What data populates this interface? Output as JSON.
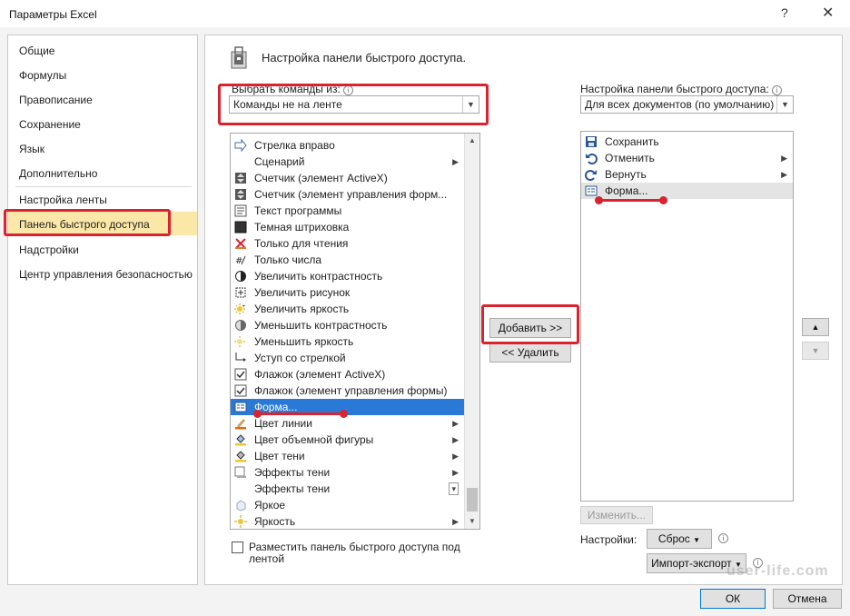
{
  "window": {
    "title": "Параметры Excel",
    "help_glyph": "?",
    "close_glyph": "✕"
  },
  "nav": {
    "items": [
      {
        "label": "Общие"
      },
      {
        "label": "Формулы"
      },
      {
        "label": "Правописание"
      },
      {
        "label": "Сохранение"
      },
      {
        "label": "Язык"
      },
      {
        "label": "Дополнительно"
      },
      {
        "label": "Настройка ленты"
      },
      {
        "label": "Панель быстрого доступа"
      },
      {
        "label": "Надстройки"
      },
      {
        "label": "Центр управления безопасностью"
      }
    ],
    "selected_index": 7
  },
  "header": {
    "title": "Настройка панели быстрого доступа."
  },
  "choose_commands": {
    "label": "Выбрать команды из:",
    "value": "Команды не на ленте"
  },
  "customize_qat": {
    "label": "Настройка панели быстрого доступа:",
    "value": "Для всех документов (по умолчанию)"
  },
  "commands_list": {
    "items": [
      {
        "label": "Стрелка вправо",
        "icon": "arrow-right-icon",
        "submenu": false
      },
      {
        "label": "Сценарий",
        "icon": "none",
        "submenu": true
      },
      {
        "label": "Счетчик (элемент ActiveX)",
        "icon": "spinner-icon",
        "submenu": false
      },
      {
        "label": "Счетчик (элемент управления форм...",
        "icon": "spinner-icon",
        "submenu": false
      },
      {
        "label": "Текст программы",
        "icon": "code-text-icon",
        "submenu": false
      },
      {
        "label": "Темная штриховка",
        "icon": "dark-shading-icon",
        "submenu": false
      },
      {
        "label": "Только для чтения",
        "icon": "read-only-icon",
        "submenu": false
      },
      {
        "label": "Только числа",
        "icon": "numbers-only-icon",
        "submenu": false
      },
      {
        "label": "Увеличить контрастность",
        "icon": "contrast-up-icon",
        "submenu": false
      },
      {
        "label": "Увеличить рисунок",
        "icon": "enlarge-picture-icon",
        "submenu": false
      },
      {
        "label": "Увеличить яркость",
        "icon": "brightness-up-icon",
        "submenu": false
      },
      {
        "label": "Уменьшить контрастность",
        "icon": "contrast-down-icon",
        "submenu": false
      },
      {
        "label": "Уменьшить яркость",
        "icon": "brightness-down-icon",
        "submenu": false
      },
      {
        "label": "Уступ со стрелкой",
        "icon": "elbow-arrow-icon",
        "submenu": false
      },
      {
        "label": "Флажок (элемент ActiveX)",
        "icon": "checkbox-icon",
        "submenu": false
      },
      {
        "label": "Флажок (элемент управления формы)",
        "icon": "checkbox-icon",
        "submenu": false
      },
      {
        "label": "Форма...",
        "icon": "form-icon",
        "submenu": false,
        "selected": true
      },
      {
        "label": "Цвет линии",
        "icon": "line-color-icon",
        "submenu": true
      },
      {
        "label": "Цвет объемной фигуры",
        "icon": "fill-3d-color-icon",
        "submenu": true
      },
      {
        "label": "Цвет тени",
        "icon": "shadow-color-icon",
        "submenu": true
      },
      {
        "label": "Эффекты тени",
        "icon": "shadow-effects-icon",
        "submenu": true
      },
      {
        "label": "Эффекты тени",
        "icon": "none",
        "submenu": false,
        "dropdown": true
      },
      {
        "label": "Яркое",
        "icon": "bright-icon",
        "submenu": false
      },
      {
        "label": "Яркость",
        "icon": "brightness-icon",
        "submenu": true
      }
    ]
  },
  "qat_list": {
    "items": [
      {
        "label": "Сохранить",
        "icon": "save-icon",
        "submenu": false
      },
      {
        "label": "Отменить",
        "icon": "undo-icon",
        "submenu": true
      },
      {
        "label": "Вернуть",
        "icon": "redo-icon",
        "submenu": true
      },
      {
        "label": "Форма...",
        "icon": "form-icon",
        "submenu": false,
        "selected": true
      }
    ]
  },
  "buttons": {
    "add": "Добавить >>",
    "remove": "<< Удалить",
    "modify": "Изменить...",
    "reset": "Сброс",
    "import_export": "Импорт-экспорт",
    "ok": "ОК",
    "cancel": "Отмена",
    "move_up": "▲",
    "move_down": "▼"
  },
  "settings_label": "Настройки:",
  "show_below_ribbon": {
    "label": "Разместить панель быстрого доступа под лентой",
    "checked": false
  },
  "watermark": "user-life.com",
  "colors": {
    "highlight": "#d9232e",
    "selection": "#2b79d7",
    "nav_selected": "#fbe8a8"
  }
}
